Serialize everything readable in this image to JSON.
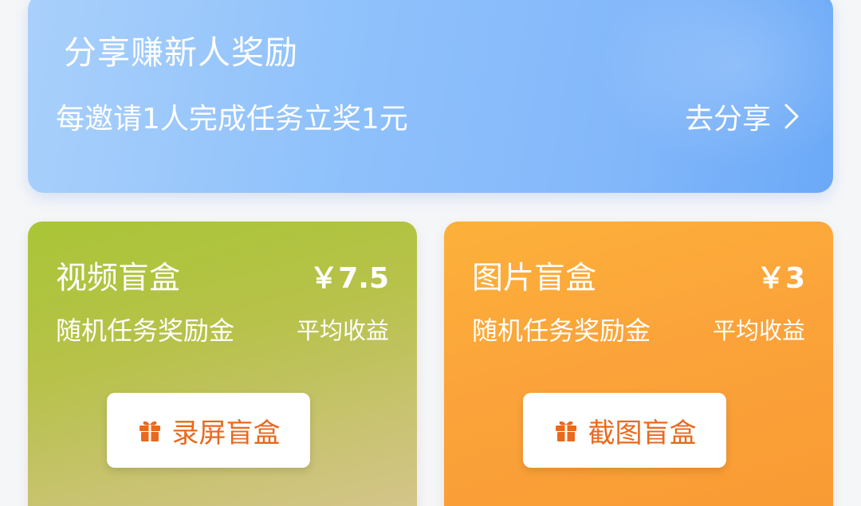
{
  "invite": {
    "title": "分享赚新人奖励",
    "description": "每邀请1人完成任务立奖1元",
    "share_label": "去分享",
    "share_icon": "chevron-right-icon"
  },
  "cards": [
    {
      "title": "视频盲盒",
      "price": "￥7.5",
      "subtitle": "随机任务奖励金",
      "metric": "平均收益",
      "button_label": "录屏盲盒",
      "button_icon": "gift-icon"
    },
    {
      "title": "图片盲盒",
      "price": "￥3",
      "subtitle": "随机任务奖励金",
      "metric": "平均收益",
      "button_label": "截图盲盒",
      "button_icon": "gift-icon"
    }
  ],
  "colors": {
    "banner_blue": "#8fc1fb",
    "video_card_green": "#a9c536",
    "image_card_orange": "#fba33a",
    "button_text_orange": "#e9691e"
  }
}
